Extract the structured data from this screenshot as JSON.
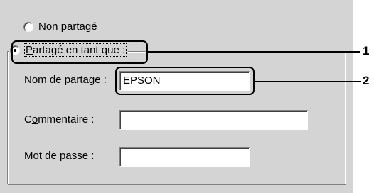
{
  "dialog": {
    "radio_not_shared": {
      "prefix": "",
      "accel": "N",
      "suffix": "on partagé",
      "selected": false
    },
    "radio_shared_as": {
      "prefix": "",
      "accel": "P",
      "suffix": "artagé en tant que :",
      "selected": true
    },
    "fields": {
      "share_name": {
        "label_before": "Nom de par",
        "label_accel": "t",
        "label_after": "age :",
        "value": "EPSON"
      },
      "comment": {
        "label_before": "C",
        "label_accel": "o",
        "label_after": "mmentaire :",
        "value": ""
      },
      "password": {
        "label_before": "",
        "label_accel": "M",
        "label_after": "ot de passe :",
        "value": ""
      }
    }
  },
  "callouts": {
    "one": "1",
    "two": "2"
  },
  "colors": {
    "dialog_bg": "#d4d4d4",
    "callout": "#000000"
  }
}
